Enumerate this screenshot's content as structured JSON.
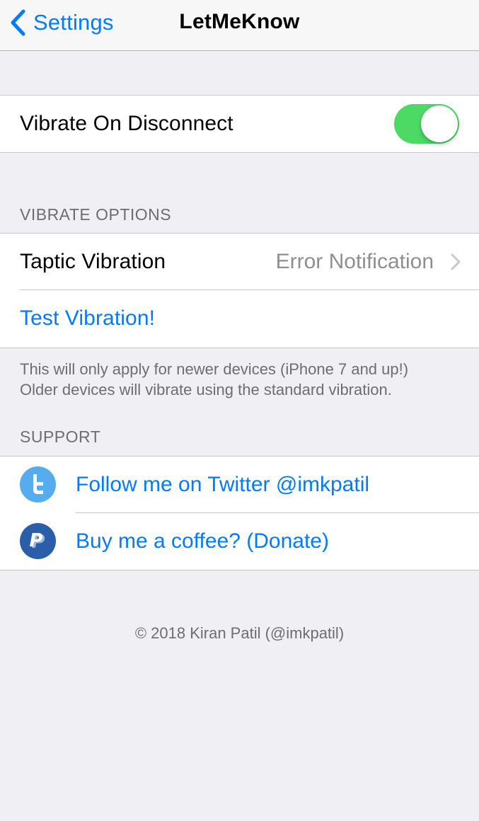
{
  "nav": {
    "back_label": "Settings",
    "title": "LetMeKnow",
    "back_icon": "chevron-left-icon"
  },
  "main_toggle": {
    "label": "Vibrate On Disconnect",
    "on": true,
    "color": "#4cd964"
  },
  "vibrate_options": {
    "header": "VIBRATE OPTIONS",
    "taptic_label": "Taptic Vibration",
    "taptic_value": "Error Notification",
    "test_label": "Test Vibration!",
    "footer_line1": "This will only apply for newer devices (iPhone 7 and up!)",
    "footer_line2": "Older devices will vibrate using the standard vibration."
  },
  "support": {
    "header": "SUPPORT",
    "items": [
      {
        "icon": "twitter-icon",
        "label": "Follow me on Twitter @imkpatil",
        "color": "#55acee"
      },
      {
        "icon": "paypal-icon",
        "label": "Buy me a coffee? (Donate)",
        "color": "#2b5ea9"
      }
    ]
  },
  "copyright": "© 2018 Kiran Patil (@imkpatil)",
  "colors": {
    "accent": "#007aff",
    "background": "#efeff4",
    "secondary_text": "#6d6d72"
  }
}
